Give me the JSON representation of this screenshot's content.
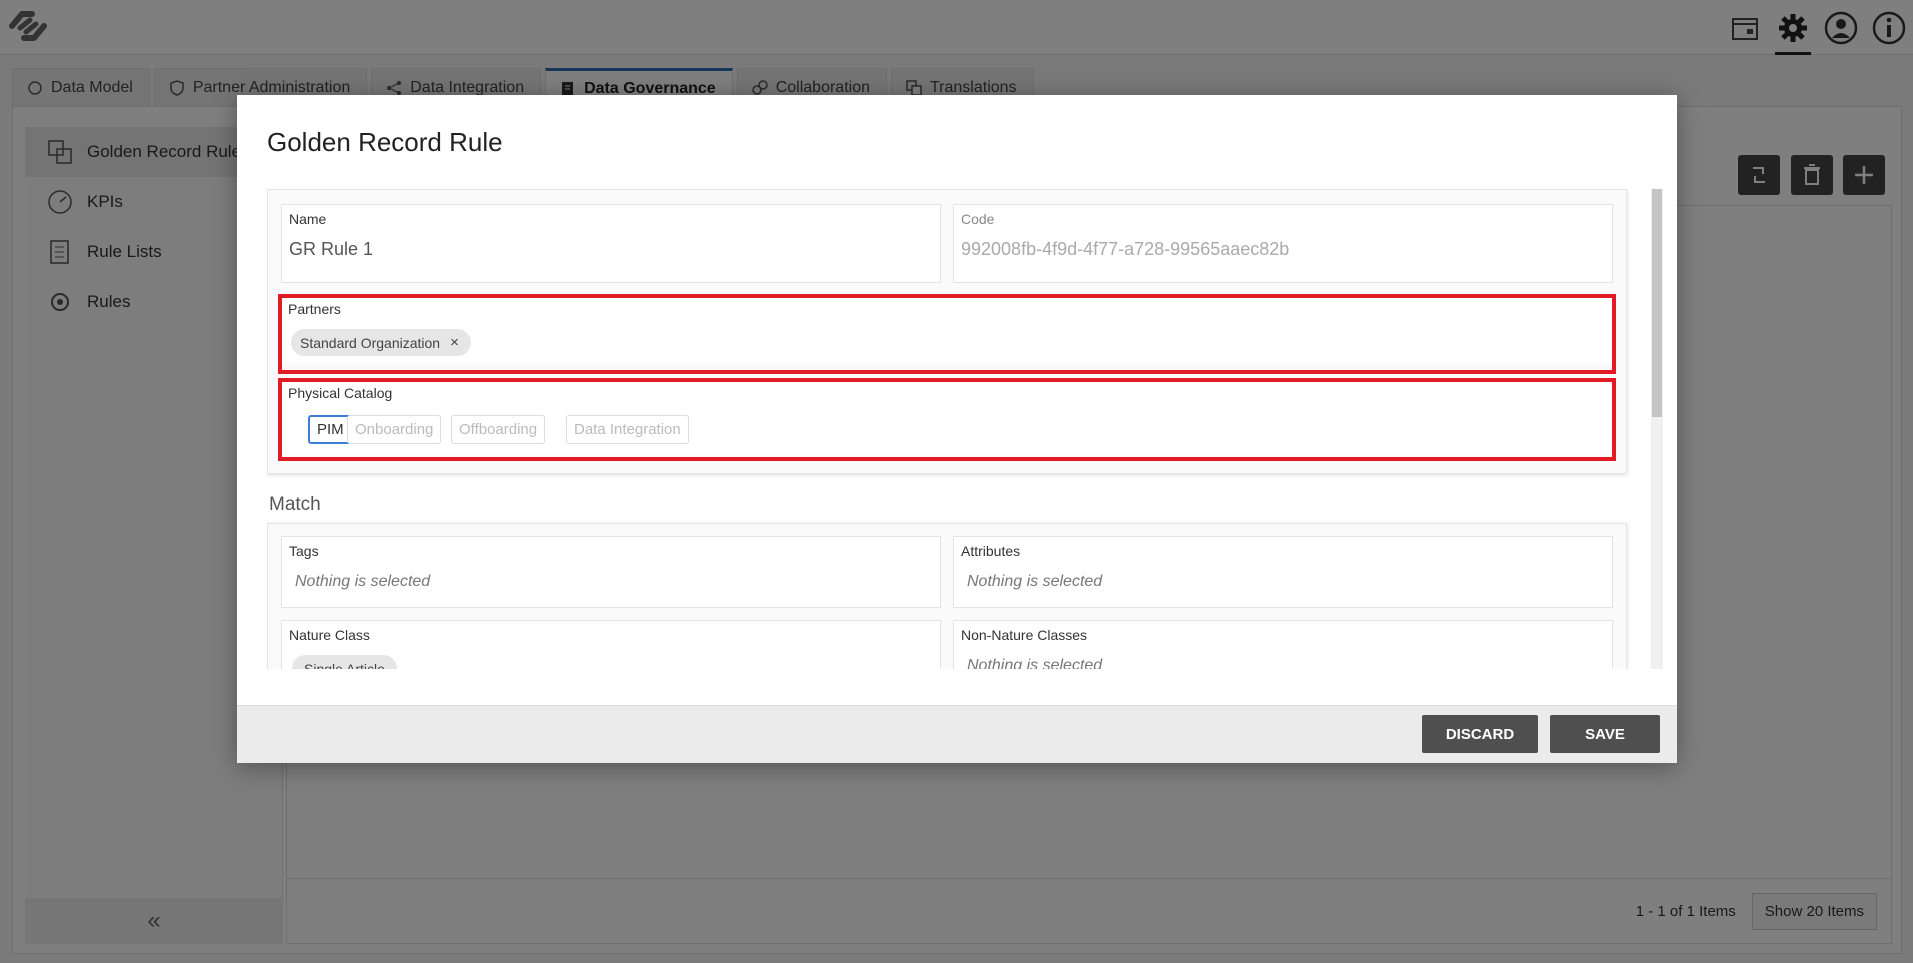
{
  "tabs": [
    {
      "label": "Data Model",
      "icon": "data-model-icon"
    },
    {
      "label": "Partner Administration",
      "icon": "shield-icon"
    },
    {
      "label": "Data Integration",
      "icon": "integration-icon"
    },
    {
      "label": "Data Governance",
      "icon": "governance-icon"
    },
    {
      "label": "Collaboration",
      "icon": "collaboration-icon"
    },
    {
      "label": "Translations",
      "icon": "translations-icon"
    }
  ],
  "sidebar": {
    "items": [
      {
        "label": "Golden Record Rules",
        "icon": "golden-record-icon"
      },
      {
        "label": "KPIs",
        "icon": "gauge-icon"
      },
      {
        "label": "Rule Lists",
        "icon": "list-icon"
      },
      {
        "label": "Rules",
        "icon": "rules-gear-icon"
      }
    ],
    "collapse_label": "«"
  },
  "grid": {
    "pager_text": "1 - 1 of 1 Items",
    "show_items_label": "Show 20 Items"
  },
  "modal": {
    "title": "Golden Record Rule",
    "name_label": "Name",
    "name_value": "GR Rule 1",
    "code_label": "Code",
    "code_value": "992008fb-4f9d-4f77-a728-99565aaec82b",
    "partners_label": "Partners",
    "partners_chip": "Standard Organization",
    "chip_remove": "×",
    "catalog_label": "Physical Catalog",
    "catalog_options": [
      "PIM",
      "Onboarding",
      "Offboarding",
      "Data Integration"
    ],
    "catalog_selected": "PIM",
    "match_title": "Match",
    "tags_label": "Tags",
    "tags_placeholder": "Nothing is selected",
    "attributes_label": "Attributes",
    "attributes_placeholder": "Nothing is selected",
    "nature_class_label": "Nature Class",
    "nature_class_value": "Single Article",
    "non_nature_label": "Non-Nature Classes",
    "non_nature_placeholder": "Nothing is selected",
    "discard_label": "DISCARD",
    "save_label": "SAVE"
  },
  "colors": {
    "highlight": "#e01b24",
    "accent": "#2f6db5",
    "button": "#4f4f4f"
  }
}
